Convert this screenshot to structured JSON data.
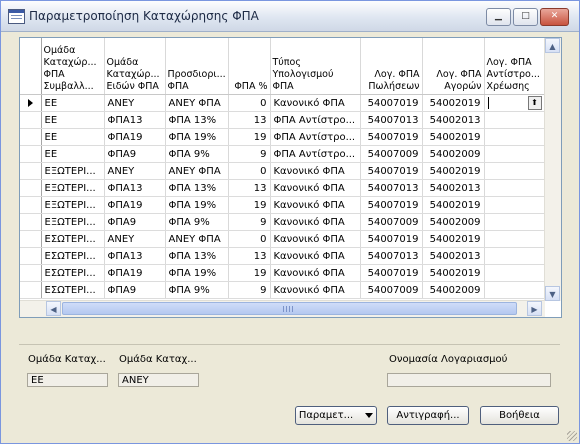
{
  "window": {
    "title": "Παραμετροποίηση Καταχώρησης ΦΠΑ",
    "controls": {
      "minimize": "▁",
      "maximize": "□",
      "close": "✕"
    }
  },
  "grid": {
    "columns": [
      "Ομάδα Καταχώρ... ΦΠΑ Συμβαλλ...",
      "Ομάδα Καταχώρ... Ειδών ΦΠΑ",
      "Προσδιορι... ΦΠΑ",
      "ΦΠΑ %",
      "Τύπος Υπολογισμού ΦΠΑ",
      "Λογ. ΦΠΑ Πωλήσεων",
      "Λογ. ΦΠΑ Αγορών",
      "Λογ. ΦΠΑ Αντίστρο... Χρέωσης"
    ],
    "rows": [
      [
        "ΕΕ",
        "ΑΝΕΥ",
        "ΑΝΕΥ ΦΠΑ",
        "0",
        "Κανονικό ΦΠΑ",
        "54007019",
        "54002019",
        ""
      ],
      [
        "ΕΕ",
        "ΦΠΑ13",
        "ΦΠΑ 13%",
        "13",
        "ΦΠΑ Αντίστρο...",
        "54007013",
        "54002013",
        ""
      ],
      [
        "ΕΕ",
        "ΦΠΑ19",
        "ΦΠΑ 19%",
        "19",
        "ΦΠΑ Αντίστρο...",
        "54007019",
        "54002019",
        ""
      ],
      [
        "ΕΕ",
        "ΦΠΑ9",
        "ΦΠΑ 9%",
        "9",
        "ΦΠΑ Αντίστρο...",
        "54007009",
        "54002009",
        ""
      ],
      [
        "ΕΞΩΤΕΡΙ...",
        "ΑΝΕΥ",
        "ΑΝΕΥ ΦΠΑ",
        "0",
        "Κανονικό ΦΠΑ",
        "54007019",
        "54002019",
        ""
      ],
      [
        "ΕΞΩΤΕΡΙ...",
        "ΦΠΑ13",
        "ΦΠΑ 13%",
        "13",
        "Κανονικό ΦΠΑ",
        "54007013",
        "54002013",
        ""
      ],
      [
        "ΕΞΩΤΕΡΙ...",
        "ΦΠΑ19",
        "ΦΠΑ 19%",
        "19",
        "Κανονικό ΦΠΑ",
        "54007019",
        "54002019",
        ""
      ],
      [
        "ΕΞΩΤΕΡΙ...",
        "ΦΠΑ9",
        "ΦΠΑ 9%",
        "9",
        "Κανονικό ΦΠΑ",
        "54007009",
        "54002009",
        ""
      ],
      [
        "ΕΣΩΤΕΡΙ...",
        "ΑΝΕΥ",
        "ΑΝΕΥ ΦΠΑ",
        "0",
        "Κανονικό ΦΠΑ",
        "54007019",
        "54002019",
        ""
      ],
      [
        "ΕΣΩΤΕΡΙ...",
        "ΦΠΑ13",
        "ΦΠΑ 13%",
        "13",
        "Κανονικό ΦΠΑ",
        "54007013",
        "54002013",
        ""
      ],
      [
        "ΕΣΩΤΕΡΙ...",
        "ΦΠΑ19",
        "ΦΠΑ 19%",
        "19",
        "Κανονικό ΦΠΑ",
        "54007019",
        "54002019",
        ""
      ],
      [
        "ΕΣΩΤΕΡΙ...",
        "ΦΠΑ9",
        "ΦΠΑ 9%",
        "9",
        "Κανονικό ΦΠΑ",
        "54007009",
        "54002009",
        ""
      ]
    ],
    "current_row": 0
  },
  "details": {
    "field1_label": "Ομάδα Καταχ...",
    "field1_value": "ΕΕ",
    "field2_label": "Ομάδα Καταχ...",
    "field2_value": "ΑΝΕΥ",
    "field3_label": "Ονομασία Λογαριασμού",
    "field3_value": ""
  },
  "buttons": {
    "params": "Παραμετ...",
    "copy": "Αντιγραφή...",
    "help": "Βοήθεια"
  }
}
